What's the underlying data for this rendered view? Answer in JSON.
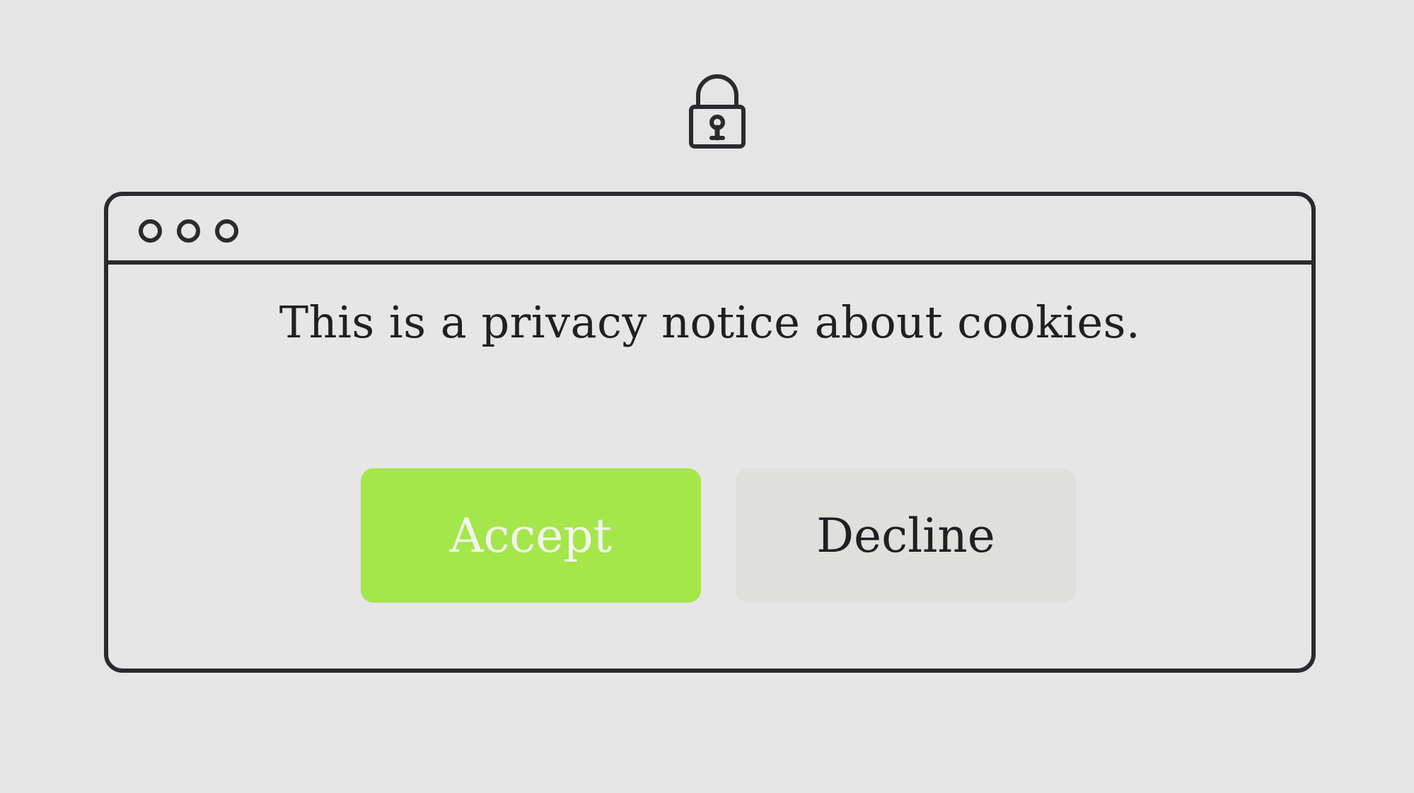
{
  "icons": {
    "top": "lock-icon",
    "window_controls": [
      "dot-icon",
      "dot-icon",
      "dot-icon"
    ]
  },
  "dialog": {
    "message": "This is a privacy notice about cookies.",
    "accept_label": "Accept",
    "decline_label": "Decline"
  },
  "colors": {
    "background": "#e5e5e5",
    "outline": "#2a2b2e",
    "accept": "#a5e64b",
    "accept_text": "#f1f6ea",
    "decline": "#dfe0dc",
    "text": "#1f2022"
  }
}
